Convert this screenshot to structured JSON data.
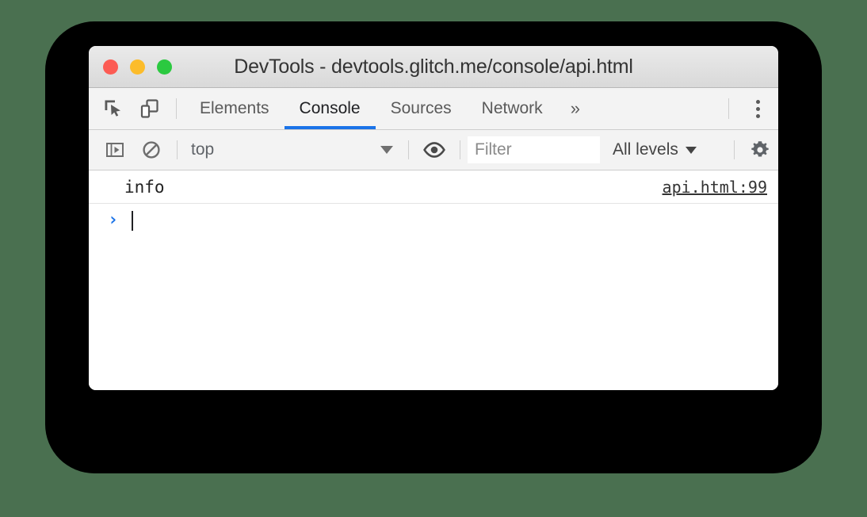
{
  "theme": {
    "page_background": "#4a7050",
    "backdrop": "#000000",
    "window_background": "#ffffff",
    "toolbar_background": "#f3f3f3",
    "accent": "#1a73e8",
    "text": "#5a5a5a"
  },
  "window": {
    "title": "DevTools - devtools.glitch.me/console/api.html",
    "traffic_lights": [
      {
        "name": "close",
        "color": "#fc5b53"
      },
      {
        "name": "minimize",
        "color": "#fcbc2a"
      },
      {
        "name": "zoom",
        "color": "#2bc940"
      }
    ]
  },
  "tabbar": {
    "inspect_icon": "inspect-element-icon",
    "device_icon": "device-toolbar-icon",
    "tabs": [
      {
        "label": "Elements",
        "active": false
      },
      {
        "label": "Console",
        "active": true
      },
      {
        "label": "Sources",
        "active": false
      },
      {
        "label": "Network",
        "active": false
      }
    ],
    "more_tabs_label": "»",
    "menu_icon": "more-vertical-icon"
  },
  "console_toolbar": {
    "sidebar_toggle_icon": "console-sidebar-icon",
    "clear_icon": "clear-console-icon",
    "context": {
      "value": "top",
      "caret_icon": "chevron-down-icon"
    },
    "eye_icon": "live-expression-eye-icon",
    "filter": {
      "placeholder": "Filter",
      "value": ""
    },
    "levels": {
      "label": "All levels",
      "caret_icon": "chevron-down-icon"
    },
    "settings_icon": "gear-icon"
  },
  "console": {
    "messages": [
      {
        "text": "info",
        "source": "api.html:99"
      }
    ],
    "prompt": {
      "arrow": "›",
      "input_value": ""
    }
  }
}
